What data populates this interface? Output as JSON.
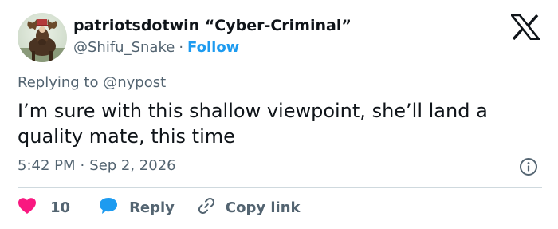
{
  "author": {
    "display_name": "patriotsdotwin “Cyber-Criminal”",
    "handle": "@Shifu_Snake",
    "separator": "·",
    "follow_label": "Follow",
    "avatar_icon": "moose-avatar-icon"
  },
  "brand": {
    "logo_icon": "x-logo-icon"
  },
  "reply_context": {
    "prefix": "Replying to",
    "mention": "@nypost"
  },
  "tweet": {
    "text": "I’m sure with this shallow viewpoint, she’ll land a quality mate, this time",
    "time": "5:42 PM",
    "separator": "·",
    "date": "Sep 2, 2026",
    "info_icon": "info-icon"
  },
  "actions": {
    "like_count": "10",
    "like_icon": "heart-icon",
    "reply_label": "Reply",
    "reply_icon": "speech-bubble-icon",
    "copy_label": "Copy link",
    "copy_icon": "link-icon"
  },
  "colors": {
    "text_primary": "#0f1419",
    "text_secondary": "#536471",
    "accent": "#1d9bf0",
    "like": "#f91880",
    "reply": "#1d9bf0",
    "divider": "#cfd9de"
  }
}
